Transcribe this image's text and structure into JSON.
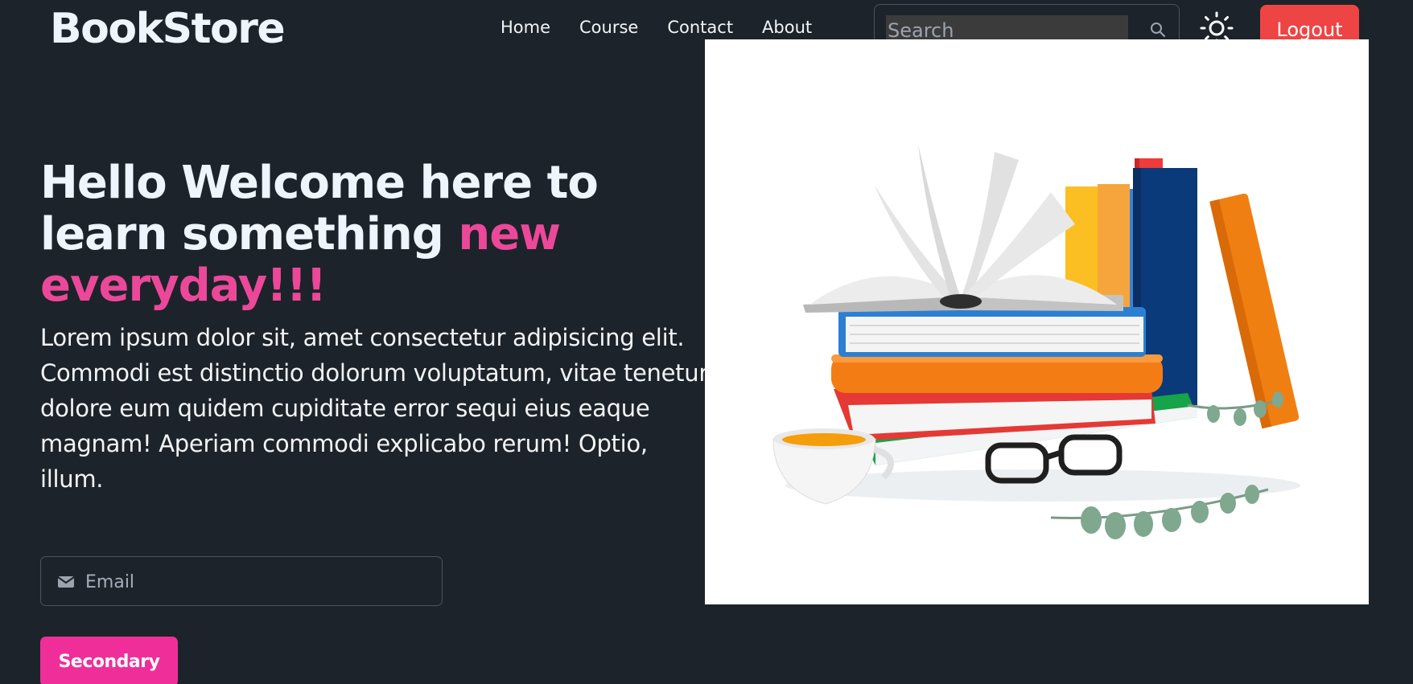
{
  "header": {
    "brand": "BookStore",
    "nav": [
      {
        "label": "Home"
      },
      {
        "label": "Course"
      },
      {
        "label": "Contact"
      },
      {
        "label": "About"
      }
    ],
    "search": {
      "placeholder": "Search",
      "value": ""
    },
    "search_icon": "search-icon",
    "theme_icon": "sun-icon",
    "logout_label": "Logout"
  },
  "hero": {
    "title_main": "Hello Welcome here to learn something ",
    "title_accent": "new everyday!!!",
    "text": "Lorem ipsum dolor sit, amet consectetur adipisicing elit. Commodi est distinctio dolorum voluptatum, vitae tenetur dolore eum quidem cupiditate error sequi eius eaque magnam! Aperiam commodi explicabo rerum! Optio, illum.",
    "email": {
      "placeholder": "Email",
      "value": ""
    },
    "email_icon": "envelope-icon",
    "button_label": "Secondary"
  },
  "illustration": {
    "name": "books-illustration"
  },
  "colors": {
    "background": "#1d232a",
    "accent_pink": "#ec4899",
    "button_pink": "#f02e9a",
    "logout_red": "#ef4444"
  }
}
